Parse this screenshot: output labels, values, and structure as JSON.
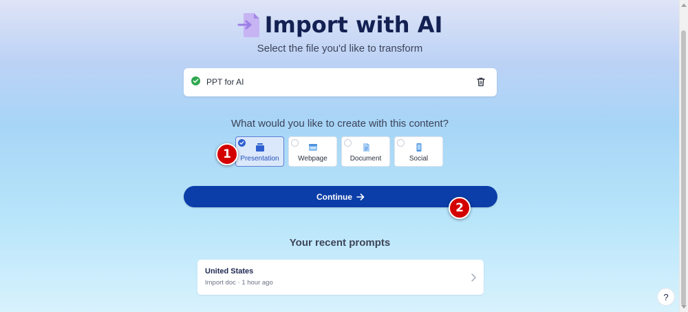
{
  "header": {
    "title": "Import with AI",
    "subtitle": "Select the file you'd like to transform",
    "icon": "file-import-icon"
  },
  "file": {
    "name": "PPT for AI",
    "status_icon": "check-circle-icon",
    "delete_icon": "trash-icon"
  },
  "question": "What would you like to create with this content?",
  "options": [
    {
      "label": "Presentation",
      "icon": "presentation-icon",
      "selected": true
    },
    {
      "label": "Webpage",
      "icon": "webpage-icon",
      "selected": false
    },
    {
      "label": "Document",
      "icon": "document-icon",
      "selected": false
    },
    {
      "label": "Social",
      "icon": "phone-icon",
      "selected": false
    }
  ],
  "continue_label": "Continue",
  "recent": {
    "heading": "Your recent prompts",
    "items": [
      {
        "title": "United States",
        "meta": "Import doc · 1 hour ago"
      }
    ]
  },
  "markers": [
    "1",
    "2"
  ],
  "help_label": "?",
  "colors": {
    "primary": "#0b3ea8",
    "accent": "#2f5fd0",
    "success": "#2fa84f",
    "marker": "#d40000",
    "title": "#132052"
  }
}
